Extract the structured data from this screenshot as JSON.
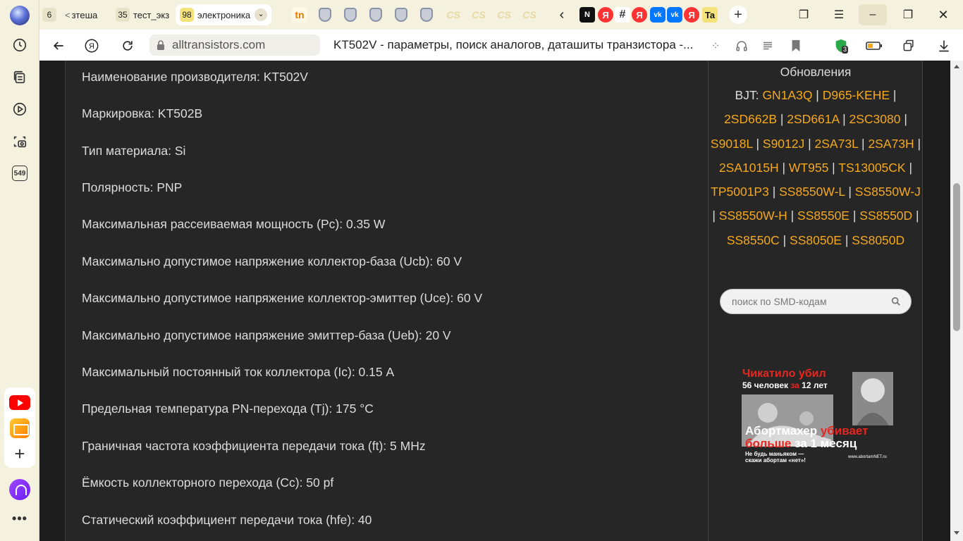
{
  "sidebar": {
    "badge_label": "549"
  },
  "tabs": {
    "group1": {
      "count": "6"
    },
    "group2": {
      "count": "",
      "label": "зтеша"
    },
    "group3": {
      "count": "35",
      "label": "тест_экз"
    },
    "group4": {
      "count": "98",
      "label": "электроника"
    }
  },
  "address": {
    "url": "alltransistors.com",
    "page_title": "KT502V - параметры, поиск аналогов, даташиты транзистора -...",
    "shield_count": "3"
  },
  "params": [
    "Наименование производителя: KT502V",
    "Маркировка: KT502В",
    "Тип материала: Si",
    "Полярность: PNP",
    "Максимальная рассеиваемая мощность (Pc): 0.35 W",
    "Максимально допустимое напряжение коллектор-база (Ucb): 60 V",
    "Максимально допустимое напряжение коллектор-эмиттер (Uce): 60 V",
    "Максимально допустимое напряжение эмиттер-база (Ueb): 20 V",
    "Максимальный постоянный ток коллектора (Ic): 0.15 A",
    "Предельная температура PN-перехода (Tj): 175 °C",
    "Граничная частота коэффициента передачи тока (ft): 5 MHz",
    "Ёмкость коллекторного перехода (Cc): 50 pf",
    "Статический коэффициент передачи тока (hfe): 40"
  ],
  "updates": {
    "title": "Обновления",
    "prefix": "BJT: ",
    "sep": " | ",
    "links": [
      "GN1A3Q",
      "D965-KEHE",
      "2SD662B",
      "2SD661A",
      "2SC3080",
      "S9018L",
      "S9012J",
      "2SA73L",
      "2SA73H",
      "2SA1015H",
      "WT955",
      "TS13005CK",
      "TP5001P3",
      "SS8550W-L",
      "SS8550W-J",
      "SS8550W-H",
      "SS8550E",
      "SS8550D",
      "SS8550C",
      "SS8050E",
      "SS8050D"
    ]
  },
  "smd_search": {
    "placeholder": "поиск по SMD-кодам"
  },
  "banner": {
    "line1": "Чикатило убил",
    "line2a": "56 человек ",
    "line2b": "за",
    "line2c": " 12 лет",
    "line3a": "Абортмахер ",
    "line3b": "убивает",
    "line4a": "больше",
    "line4b": " за 1 месяц",
    "line5": "Не будь маньяком —",
    "line6": "скажи абортам «нет»!",
    "site": "www.abortamNET.ru"
  },
  "colors": {
    "link": "#f5a81c",
    "page_bg": "#262626",
    "banner_red": "#e8261f"
  }
}
